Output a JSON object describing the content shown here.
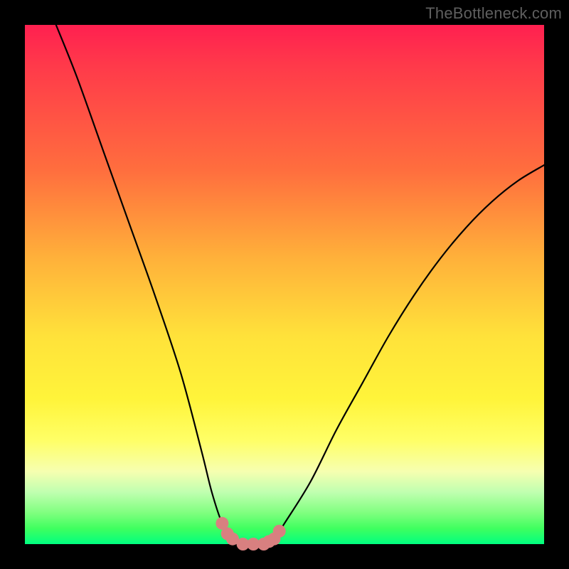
{
  "watermark": "TheBottleneck.com",
  "chart_data": {
    "type": "line",
    "title": "",
    "xlabel": "",
    "ylabel": "",
    "xlim": [
      0,
      100
    ],
    "ylim": [
      0,
      100
    ],
    "series": [
      {
        "name": "bottleneck-curve",
        "x": [
          6,
          10,
          15,
          20,
          25,
          30,
          34,
          36,
          38,
          40,
          42,
          44,
          46,
          48,
          50,
          55,
          60,
          65,
          70,
          75,
          80,
          85,
          90,
          95,
          100
        ],
        "y": [
          100,
          90,
          76,
          62,
          48,
          33,
          18,
          10,
          4,
          1,
          0,
          0,
          0,
          1,
          4,
          12,
          22,
          31,
          40,
          48,
          55,
          61,
          66,
          70,
          73
        ]
      }
    ],
    "markers": {
      "name": "trough-markers",
      "color": "#d88080",
      "points": [
        {
          "x": 38,
          "y": 4
        },
        {
          "x": 39,
          "y": 2
        },
        {
          "x": 40,
          "y": 1
        },
        {
          "x": 42,
          "y": 0
        },
        {
          "x": 44,
          "y": 0
        },
        {
          "x": 46,
          "y": 0
        },
        {
          "x": 47,
          "y": 0.5
        },
        {
          "x": 48,
          "y": 1
        },
        {
          "x": 49,
          "y": 2.5
        }
      ]
    },
    "background_gradient": {
      "top": "#ff2050",
      "mid": "#ffe23a",
      "bottom": "#00ff80"
    }
  }
}
